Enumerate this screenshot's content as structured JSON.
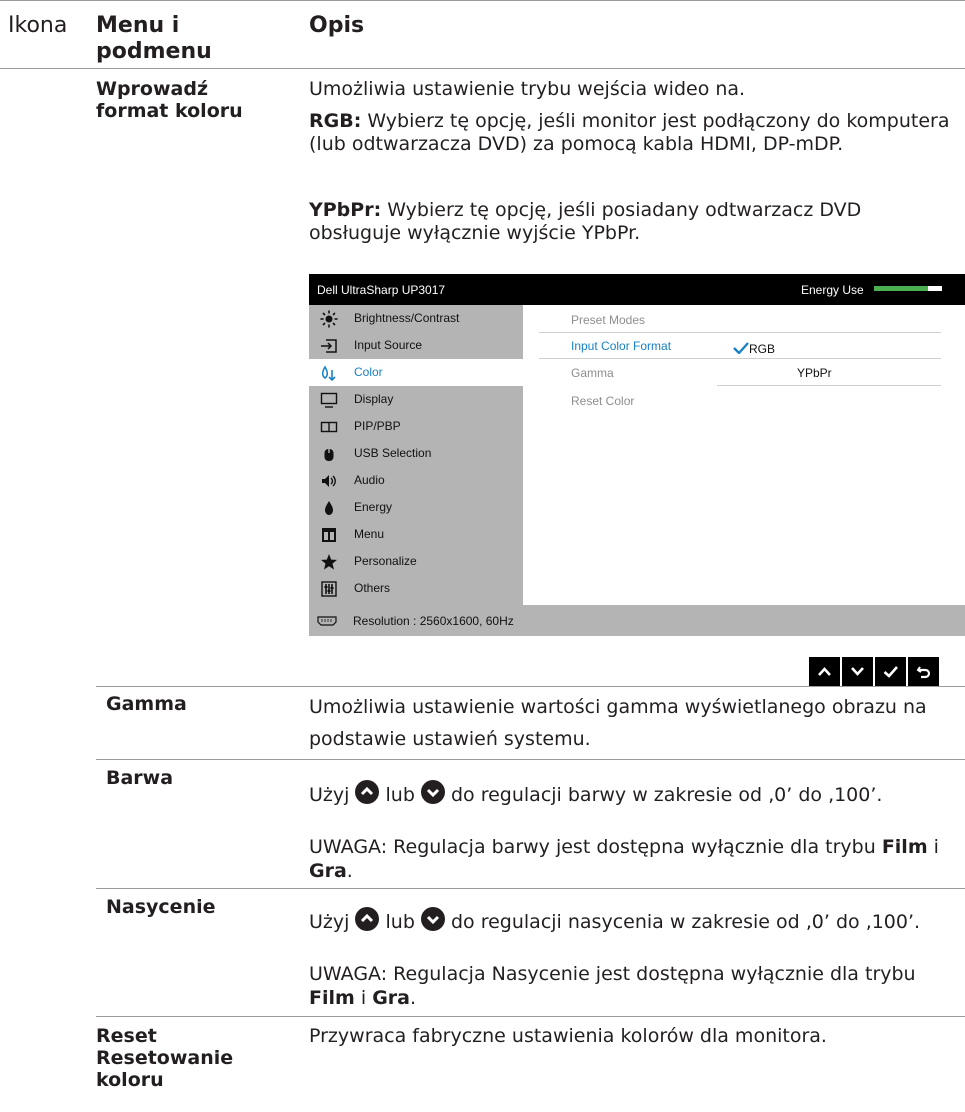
{
  "header": {
    "col_icon": "Ikona",
    "col_menu": "Menu i podmenu",
    "col_desc": "Opis"
  },
  "input_color_format": {
    "term": "Wprowadź format koloru",
    "intro": "Umożliwia ustawienie trybu wejścia wideo na.",
    "rgb_label": "RGB:",
    "rgb_text": "Wybierz tę opcję, jeśli monitor jest podłączony do komputera (lub odtwarzacza DVD) za pomocą kabla HDMI, DP-mDP.",
    "ypbpr_label": "YPbPr:",
    "ypbpr_text": "Wybierz tę opcję, jeśli posiadany odtwarzacz DVD obsługuje wyłącznie wyjście YPbPr."
  },
  "osd": {
    "title": "Dell UltraSharp UP3017",
    "energy_label": "Energy Use",
    "energy_level": 0.8,
    "menu_items": [
      {
        "label": "Brightness/Contrast",
        "icon": "brightness-icon"
      },
      {
        "label": "Input Source",
        "icon": "input-source-icon"
      },
      {
        "label": "Color",
        "icon": "color-icon"
      },
      {
        "label": "Display",
        "icon": "display-icon"
      },
      {
        "label": "PIP/PBP",
        "icon": "pip-pbp-icon"
      },
      {
        "label": "USB Selection",
        "icon": "usb-icon"
      },
      {
        "label": "Audio",
        "icon": "audio-icon"
      },
      {
        "label": "Energy",
        "icon": "energy-icon"
      },
      {
        "label": "Menu",
        "icon": "menu-icon"
      },
      {
        "label": "Personalize",
        "icon": "star-icon"
      },
      {
        "label": "Others",
        "icon": "others-icon"
      }
    ],
    "submenu": [
      "Preset Modes",
      "Input Color Format",
      "Gamma",
      "Reset Color"
    ],
    "options": [
      "RGB",
      "YPbPr"
    ],
    "resolution": "Resolution : 2560x1600, 60Hz",
    "accent": "#1a82c4"
  },
  "nav_buttons": [
    "up-icon",
    "down-icon",
    "check-icon",
    "back-icon"
  ],
  "gamma": {
    "term": "Gamma",
    "text": "Umożliwia ustawienie wartości gamma wyświetlanego obrazu na podstawie ustawień systemu."
  },
  "hue": {
    "term": "Barwa",
    "use": "Użyj",
    "or": "lub",
    "rest": "do regulacji barwy w zakresie od ‚0’ do ‚100’.",
    "note_label": "UWAGA:",
    "note_text": "Regulacja barwy jest dostępna wyłącznie dla trybu",
    "mode1": "Film",
    "conj": "i",
    "mode2": "Gra",
    "end": "."
  },
  "saturation": {
    "term": "Nasycenie",
    "use": "Użyj",
    "or": "lub",
    "rest": "do regulacji nasycenia w zakresie od ‚0’ do ‚100’.",
    "note_label": "UWAGA:",
    "note_text": "Regulacja Nasycenie jest dostępna wyłącznie dla trybu",
    "mode1": "Film",
    "conj": "i",
    "mode2": "Gra",
    "end": "."
  },
  "reset": {
    "term1": "Reset",
    "term2": "Resetowanie koloru",
    "text": "Przywraca fabryczne ustawienia kolorów dla monitora."
  }
}
